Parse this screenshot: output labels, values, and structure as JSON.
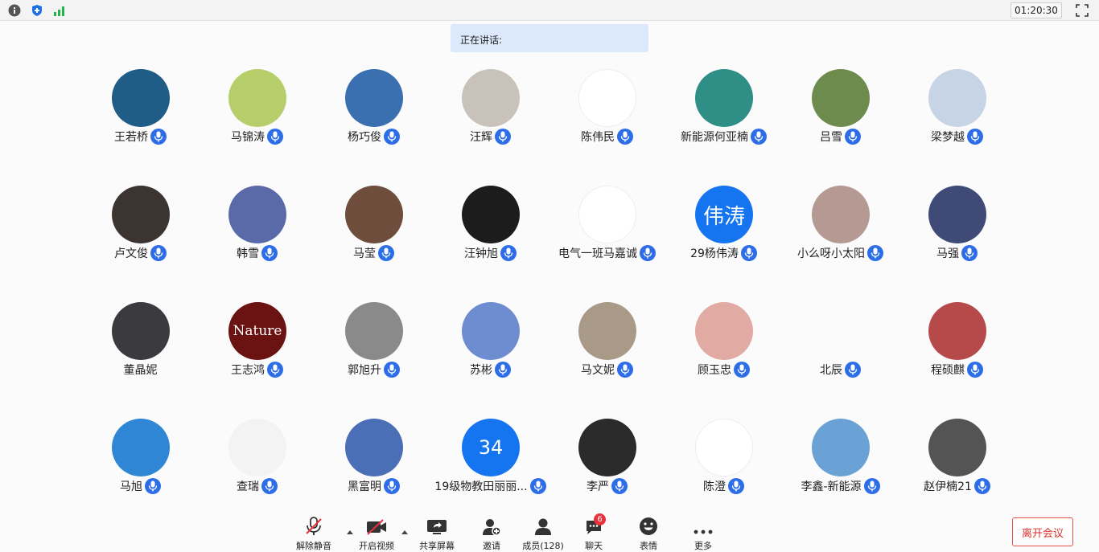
{
  "topbar": {
    "timer": "01:20:30",
    "icons": [
      "info-icon",
      "shield-icon",
      "signal-icon",
      "fullscreen-icon"
    ]
  },
  "speaking": {
    "label": "正在讲话:"
  },
  "participants": [
    {
      "name": "王若桥",
      "avatar": "#1f5c86"
    },
    {
      "name": "马锦涛",
      "avatar": "#b6cf6a"
    },
    {
      "name": "杨巧俊",
      "avatar": "#3a6fb0"
    },
    {
      "name": "汪辉",
      "avatar": "#c9c2ba"
    },
    {
      "name": "陈伟民",
      "avatar": "#ffffff"
    },
    {
      "name": "新能源何亚楠",
      "avatar": "#2f8f86"
    },
    {
      "name": "吕雪",
      "avatar": "#6e8b4e"
    },
    {
      "name": "梁梦越",
      "avatar": "#c7d4e6"
    },
    {
      "name": "卢文俊",
      "avatar": "#3c3431"
    },
    {
      "name": "韩雪",
      "avatar": "#5a6aa8"
    },
    {
      "name": "马莹",
      "avatar": "#6e4d3c"
    },
    {
      "name": "汪钟旭",
      "avatar": "#1c1c1c"
    },
    {
      "name": "电气一班马嘉诚",
      "avatar": "#ffffff"
    },
    {
      "name": "29杨伟涛",
      "avatar": "#1574f0",
      "initials": "伟涛"
    },
    {
      "name": "小么呀小太阳",
      "avatar": "#b59a93"
    },
    {
      "name": "马强",
      "avatar": "#3f4b76"
    },
    {
      "name": "董晶妮",
      "avatar": "#3a3a3f",
      "mic": false
    },
    {
      "name": "王志鸿",
      "avatar": "#6b1212",
      "initials": "Nature"
    },
    {
      "name": "郭旭升",
      "avatar": "#8a8a8a"
    },
    {
      "name": "苏彬",
      "avatar": "#6d8dd0"
    },
    {
      "name": "马文妮",
      "avatar": "#a99a88"
    },
    {
      "name": "顾玉忠",
      "avatar": "#e1aaa2"
    },
    {
      "name": "北辰",
      "avatar": null
    },
    {
      "name": "程硕麒",
      "avatar": "#b64a4a"
    },
    {
      "name": "马旭",
      "avatar": "#2e86d4"
    },
    {
      "name": "查瑞",
      "avatar": "#f3f3f3"
    },
    {
      "name": "黑富明",
      "avatar": "#4b6fb7"
    },
    {
      "name": "19级物教田丽丽...",
      "avatar": "#1574f0",
      "initials": "34"
    },
    {
      "name": "李严",
      "avatar": "#2b2b2b"
    },
    {
      "name": "陈澄",
      "avatar": "#ffffff"
    },
    {
      "name": "李鑫-新能源",
      "avatar": "#6aa2d6"
    },
    {
      "name": "赵伊楠21",
      "avatar": "#545454"
    }
  ],
  "toolbar": {
    "unmute": "解除静音",
    "video": "开启视频",
    "share": "共享屏幕",
    "invite": "邀请",
    "members": "成员(128)",
    "chat": "聊天",
    "chat_badge": "6",
    "emoji": "表情",
    "more": "更多",
    "leave": "离开会议"
  },
  "colors": {
    "accent": "#2d6ee8",
    "leave": "#d9322b"
  }
}
